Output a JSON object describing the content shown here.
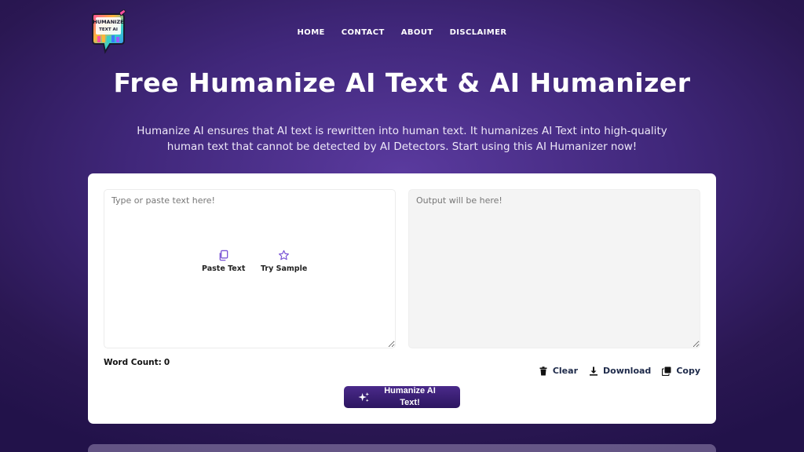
{
  "logo": {
    "text_line1": "HUMANIZE",
    "text_line2": "TEXT AI"
  },
  "nav": {
    "items": [
      "HOME",
      "CONTACT",
      "ABOUT",
      "DISCLAIMER"
    ]
  },
  "hero": {
    "title": "Free Humanize AI Text & AI Humanizer",
    "subtitle": "Humanize AI ensures that AI text is rewritten into human text. It humanizes AI Text into high-quality human text that cannot be detected by AI Detectors. Start using this AI Humanizer now!"
  },
  "editor": {
    "input_placeholder": "Type or paste text here!",
    "output_placeholder": "Output will be here!",
    "paste_label": "Paste Text",
    "sample_label": "Try Sample",
    "word_count_label": "Word Count:",
    "word_count_value": "0",
    "clear_label": "Clear",
    "download_label": "Download",
    "copy_label": "Copy",
    "humanize_label": "Humanize AI Text!"
  },
  "colors": {
    "accent": "#7b55d6",
    "button_bg": "#3a1f74",
    "action_text": "#1e2a4a"
  }
}
